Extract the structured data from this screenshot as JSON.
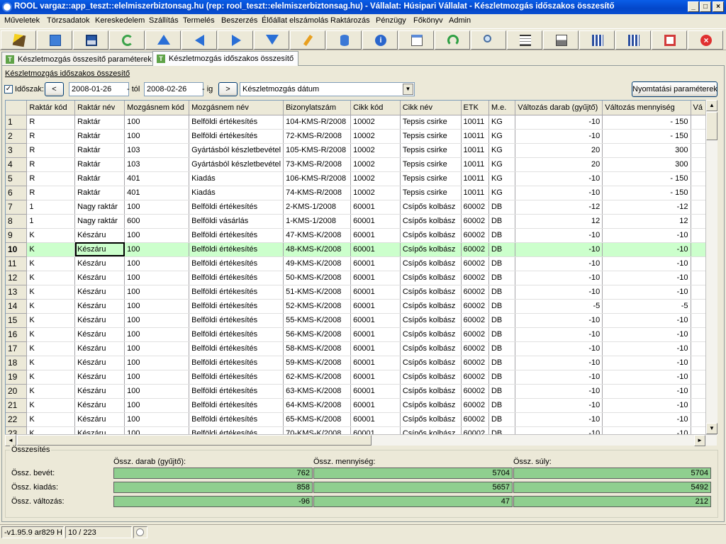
{
  "window": {
    "title": "ROOL vargaz::app_teszt::elelmiszerbiztonsag.hu (rep: rool_teszt::elelmiszerbiztonsag.hu) - Vállalat: Húsipari Vállalat - Készletmozgás időszakos összesítő"
  },
  "menu": [
    "Műveletek",
    "Törzsadatok",
    "Kereskedelem",
    "Szállítás",
    "Termelés",
    "Beszerzés",
    "Élőállat elszámolás",
    "Raktározás",
    "Pénzügy",
    "Főkönyv",
    "Admin"
  ],
  "tabs": [
    {
      "label": "Készletmozgás összesítő paraméterek"
    },
    {
      "label": "Készletmozgás időszakos összesítő"
    }
  ],
  "section_title": "Készletmozgás időszakos összesítő",
  "filter": {
    "period_label": "Időszak:",
    "from_date": "2008-01-26",
    "from_suffix": "- tól",
    "to_date": "2008-02-26",
    "to_suffix": "- ig",
    "date_type": "Készletmozgás dátum",
    "print_params": "Nyomtatási paraméterek",
    "prev": "<",
    "next": ">"
  },
  "grid": {
    "columns": [
      "Raktár kód",
      "Raktár név",
      "Mozgásnem kód",
      "Mozgásnem név",
      "Bizonylatszám",
      "Cikk kód",
      "Cikk név",
      "ETK",
      "M.e.",
      "Változás darab (gyűjtő)",
      "Változás mennyiség",
      "Vá"
    ],
    "rows": [
      [
        "1",
        "R",
        "Raktár",
        "100",
        "Belföldi értékesítés",
        "104-KMS-R/2008",
        "10002",
        "Tepsis csirke",
        "10011",
        "KG",
        "-10",
        "- 150"
      ],
      [
        "2",
        "R",
        "Raktár",
        "100",
        "Belföldi értékesítés",
        "72-KMS-R/2008",
        "10002",
        "Tepsis csirke",
        "10011",
        "KG",
        "-10",
        "- 150"
      ],
      [
        "3",
        "R",
        "Raktár",
        "103",
        "Gyártásból készletbevétel",
        "105-KMS-R/2008",
        "10002",
        "Tepsis csirke",
        "10011",
        "KG",
        "20",
        "300"
      ],
      [
        "4",
        "R",
        "Raktár",
        "103",
        "Gyártásból készletbevétel",
        "73-KMS-R/2008",
        "10002",
        "Tepsis csirke",
        "10011",
        "KG",
        "20",
        "300"
      ],
      [
        "5",
        "R",
        "Raktár",
        "401",
        "Kiadás",
        "106-KMS-R/2008",
        "10002",
        "Tepsis csirke",
        "10011",
        "KG",
        "-10",
        "- 150"
      ],
      [
        "6",
        "R",
        "Raktár",
        "401",
        "Kiadás",
        "74-KMS-R/2008",
        "10002",
        "Tepsis csirke",
        "10011",
        "KG",
        "-10",
        "- 150"
      ],
      [
        "7",
        "1",
        "Nagy raktár",
        "100",
        "Belföldi értékesítés",
        "2-KMS-1/2008",
        "60001",
        "Csípős kolbász",
        "60002",
        "DB",
        "-12",
        "-12"
      ],
      [
        "8",
        "1",
        "Nagy raktár",
        "600",
        "Belföldi vásárlás",
        "1-KMS-1/2008",
        "60001",
        "Csípős kolbász",
        "60002",
        "DB",
        "12",
        "12"
      ],
      [
        "9",
        "K",
        "Készáru",
        "100",
        "Belföldi értékesítés",
        "47-KMS-K/2008",
        "60001",
        "Csípős kolbász",
        "60002",
        "DB",
        "-10",
        "-10"
      ],
      [
        "10",
        "K",
        "Készáru",
        "100",
        "Belföldi értékesítés",
        "48-KMS-K/2008",
        "60001",
        "Csípős kolbász",
        "60002",
        "DB",
        "-10",
        "-10"
      ],
      [
        "11",
        "K",
        "Készáru",
        "100",
        "Belföldi értékesítés",
        "49-KMS-K/2008",
        "60001",
        "Csípős kolbász",
        "60002",
        "DB",
        "-10",
        "-10"
      ],
      [
        "12",
        "K",
        "Készáru",
        "100",
        "Belföldi értékesítés",
        "50-KMS-K/2008",
        "60001",
        "Csípős kolbász",
        "60002",
        "DB",
        "-10",
        "-10"
      ],
      [
        "13",
        "K",
        "Készáru",
        "100",
        "Belföldi értékesítés",
        "51-KMS-K/2008",
        "60001",
        "Csípős kolbász",
        "60002",
        "DB",
        "-10",
        "-10"
      ],
      [
        "14",
        "K",
        "Készáru",
        "100",
        "Belföldi értékesítés",
        "52-KMS-K/2008",
        "60001",
        "Csípős kolbász",
        "60002",
        "DB",
        "-5",
        "-5"
      ],
      [
        "15",
        "K",
        "Készáru",
        "100",
        "Belföldi értékesítés",
        "55-KMS-K/2008",
        "60001",
        "Csípős kolbász",
        "60002",
        "DB",
        "-10",
        "-10"
      ],
      [
        "16",
        "K",
        "Készáru",
        "100",
        "Belföldi értékesítés",
        "56-KMS-K/2008",
        "60001",
        "Csípős kolbász",
        "60002",
        "DB",
        "-10",
        "-10"
      ],
      [
        "17",
        "K",
        "Készáru",
        "100",
        "Belföldi értékesítés",
        "58-KMS-K/2008",
        "60001",
        "Csípős kolbász",
        "60002",
        "DB",
        "-10",
        "-10"
      ],
      [
        "18",
        "K",
        "Készáru",
        "100",
        "Belföldi értékesítés",
        "59-KMS-K/2008",
        "60001",
        "Csípős kolbász",
        "60002",
        "DB",
        "-10",
        "-10"
      ],
      [
        "19",
        "K",
        "Készáru",
        "100",
        "Belföldi értékesítés",
        "62-KMS-K/2008",
        "60001",
        "Csípős kolbász",
        "60002",
        "DB",
        "-10",
        "-10"
      ],
      [
        "20",
        "K",
        "Készáru",
        "100",
        "Belföldi értékesítés",
        "63-KMS-K/2008",
        "60001",
        "Csípős kolbász",
        "60002",
        "DB",
        "-10",
        "-10"
      ],
      [
        "21",
        "K",
        "Készáru",
        "100",
        "Belföldi értékesítés",
        "64-KMS-K/2008",
        "60001",
        "Csípős kolbász",
        "60002",
        "DB",
        "-10",
        "-10"
      ],
      [
        "22",
        "K",
        "Készáru",
        "100",
        "Belföldi értékesítés",
        "65-KMS-K/2008",
        "60001",
        "Csípős kolbász",
        "60002",
        "DB",
        "-10",
        "-10"
      ],
      [
        "23",
        "K",
        "Készáru",
        "100",
        "Belföldi értékesítés",
        "70-KMS-K/2008",
        "60001",
        "Csípős kolbász",
        "60002",
        "DB",
        "-10",
        "-10"
      ]
    ],
    "selected_row": 10
  },
  "summary": {
    "legend": "Összesítés",
    "col_labels": [
      "Össz. darab (gyűjtő):",
      "Össz. mennyiség:",
      "Össz. súly:"
    ],
    "rows": [
      {
        "label": "Össz. bevét:",
        "values": [
          "762",
          "5704",
          "5704"
        ]
      },
      {
        "label": "Össz. kiadás:",
        "values": [
          "858",
          "5657",
          "5492"
        ]
      },
      {
        "label": "Össz. változás:",
        "values": [
          "-96",
          "47",
          "212"
        ]
      }
    ]
  },
  "status": {
    "version": "-v1.95.9 ar829 H",
    "position": "10 / 223"
  },
  "colors": {
    "summary_fill": "#8fcf8f",
    "selected_row": "#ccffcc"
  },
  "toolbar_icons": [
    "magic-wand-icon",
    "open-folder-icon",
    "save-icon",
    "refresh-icon",
    "first-record-icon",
    "previous-record-icon",
    "next-record-icon",
    "last-record-icon",
    "edit-icon",
    "database-icon",
    "info-icon",
    "window-icon",
    "reload-icon",
    "search-icon",
    "grid-rows-icon",
    "print-icon",
    "export-grid-icon",
    "import-grid-icon",
    "fullscreen-icon",
    "exit-icon"
  ]
}
